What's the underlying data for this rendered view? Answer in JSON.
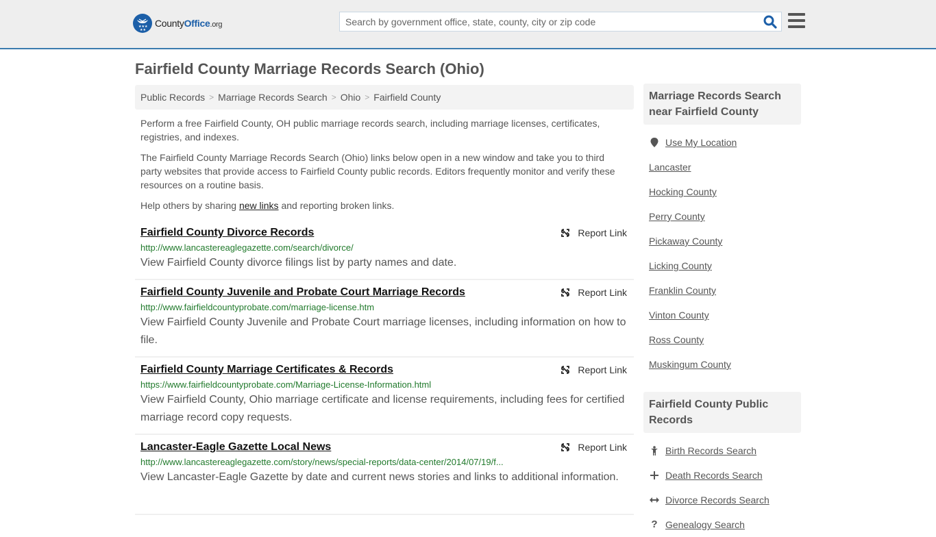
{
  "header": {
    "logo": {
      "county": "County",
      "office": "Office",
      "org": ".org"
    },
    "search": {
      "placeholder": "Search by government office, state, county, city or zip code",
      "value": ""
    },
    "accent_color": "#1c5fa8"
  },
  "page": {
    "title": "Fairfield County Marriage Records Search (Ohio)",
    "breadcrumb": [
      {
        "label": "Public Records"
      },
      {
        "label": "Marriage Records Search"
      },
      {
        "label": "Ohio"
      },
      {
        "label": "Fairfield County"
      }
    ],
    "breadcrumb_separator": ">",
    "intro": {
      "p1": "Perform a free Fairfield County, OH public marriage records search, including marriage licenses, certificates, registries, and indexes.",
      "p2": "The Fairfield County Marriage Records Search (Ohio) links below open in a new window and take you to third party websites that provide access to Fairfield County public records. Editors frequently monitor and verify these resources on a routine basis.",
      "p3_before": "Help others by sharing ",
      "p3_link": "new links",
      "p3_after": " and reporting broken links."
    }
  },
  "results": [
    {
      "title": "Fairfield County Divorce Records",
      "url": "http://www.lancastereaglegazette.com/search/divorce/",
      "description": "View Fairfield County divorce filings list by party names and date.",
      "report_label": "Report Link"
    },
    {
      "title": "Fairfield County Juvenile and Probate Court Marriage Records",
      "url": "http://www.fairfieldcountyprobate.com/marriage-license.htm",
      "description": "View Fairfield County Juvenile and Probate Court marriage licenses, including information on how to file.",
      "report_label": "Report Link"
    },
    {
      "title": "Fairfield County Marriage Certificates & Records",
      "url": "https://www.fairfieldcountyprobate.com/Marriage-License-Information.html",
      "description": "View Fairfield County, Ohio marriage certificate and license requirements, including fees for certified marriage record copy requests.",
      "report_label": "Report Link"
    },
    {
      "title": "Lancaster-Eagle Gazette Local News",
      "url": "http://www.lancastereaglegazette.com/story/news/special-reports/data-center/2014/07/19/f...",
      "description": "View Lancaster-Eagle Gazette by date and current news stories and links to additional information.",
      "report_label": "Report Link"
    }
  ],
  "sidebar": {
    "nearby": {
      "heading": "Marriage Records Search near Fairfield County",
      "use_location": "Use My Location",
      "items": [
        "Lancaster",
        "Hocking County",
        "Perry County",
        "Pickaway County",
        "Licking County",
        "Franklin County",
        "Vinton County",
        "Ross County",
        "Muskingum County"
      ]
    },
    "public_records": {
      "heading": "Fairfield County Public Records",
      "items": [
        {
          "label": "Birth Records Search",
          "icon": "child-icon"
        },
        {
          "label": "Death Records Search",
          "icon": "plus-icon"
        },
        {
          "label": "Divorce Records Search",
          "icon": "arrows-horizontal-icon"
        },
        {
          "label": "Genealogy Search",
          "icon": "question-icon"
        }
      ]
    }
  }
}
